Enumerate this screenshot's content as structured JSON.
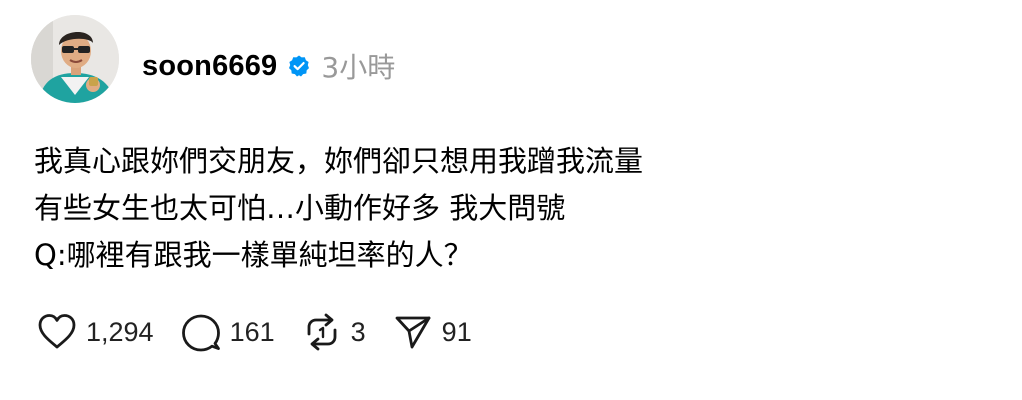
{
  "post": {
    "author": {
      "username": "soon6669",
      "verified": true,
      "avatar_icon": "avatar-photo"
    },
    "timestamp": "3小時",
    "body_lines": [
      "我真心跟妳們交朋友，妳們卻只想用我蹭我流量",
      "有些女生也太可怕…小動作好多 我大問號",
      "Q:哪裡有跟我一樣單純坦率的人？"
    ],
    "actions": {
      "like": {
        "icon": "heart-icon",
        "count": "1,294"
      },
      "comment": {
        "icon": "speech-bubble-icon",
        "count": "161"
      },
      "repost": {
        "icon": "repost-icon",
        "count": "3"
      },
      "share": {
        "icon": "send-icon",
        "count": "91"
      }
    }
  },
  "colors": {
    "text": "#000000",
    "muted": "#999999",
    "verified_badge": "#0095f6",
    "icon_stroke": "#1a1a1a"
  }
}
